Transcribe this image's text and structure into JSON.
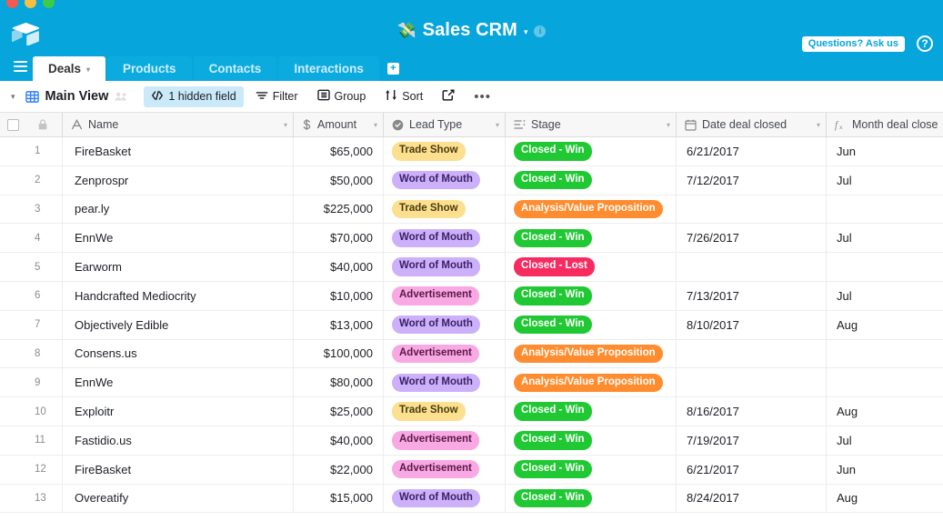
{
  "window": {
    "traffic_lights": [
      "close",
      "minimize",
      "zoom"
    ]
  },
  "header": {
    "logo_icon": "airtable-logo-icon",
    "base_icon": "money-icon",
    "base_title": "Sales CRM",
    "base_caret": "▾",
    "info_icon": "i",
    "ask_us_label": "Questions? Ask us",
    "help_label": "?"
  },
  "tabs": {
    "menu_icon": "hamburger-menu-icon",
    "items": [
      {
        "label": "Deals",
        "active": true,
        "caret": "▾"
      },
      {
        "label": "Products",
        "active": false
      },
      {
        "label": "Contacts",
        "active": false
      },
      {
        "label": "Interactions",
        "active": false
      }
    ],
    "add_label": "+"
  },
  "toolbar": {
    "view_caret": "▾",
    "view_icon": "grid-view-icon",
    "view_name": "Main View",
    "collaborators_icon": "collaborators-icon",
    "hidden_field_label": "1 hidden field",
    "hidden_field_icon": "hide-fields-icon",
    "filter_label": "Filter",
    "filter_icon": "filter-icon",
    "group_label": "Group",
    "group_icon": "group-icon",
    "sort_label": "Sort",
    "sort_icon": "sort-icon",
    "share_icon": "share-icon",
    "more_label": "•••"
  },
  "grid": {
    "select_all_icon": "checkbox-icon",
    "lock_icon": "lock-icon",
    "columns": [
      {
        "label": "Name",
        "icon": "text-field-icon",
        "caret": "▾"
      },
      {
        "label": "Amount",
        "icon": "currency-field-icon",
        "caret": "▾"
      },
      {
        "label": "Lead Type",
        "icon": "single-select-icon",
        "caret": "▾"
      },
      {
        "label": "Stage",
        "icon": "single-select-list-icon",
        "caret": "▾"
      },
      {
        "label": "Date deal closed",
        "icon": "date-field-icon",
        "caret": "▾"
      },
      {
        "label": "Month deal closed",
        "icon": "formula-field-icon",
        "caret": ""
      }
    ],
    "rows": [
      {
        "num": "1",
        "name": "FireBasket",
        "amount": "$65,000",
        "lead": "Trade Show",
        "lead_style": "trade",
        "stage": "Closed - Win",
        "stage_style": "win",
        "date": "6/21/2017",
        "month": "Jun"
      },
      {
        "num": "2",
        "name": "Zenprospr",
        "amount": "$50,000",
        "lead": "Word of Mouth",
        "lead_style": "wom",
        "stage": "Closed - Win",
        "stage_style": "win",
        "date": "7/12/2017",
        "month": "Jul"
      },
      {
        "num": "3",
        "name": "pear.ly",
        "amount": "$225,000",
        "lead": "Trade Show",
        "lead_style": "trade",
        "stage": "Analysis/Value Proposition",
        "stage_style": "anal",
        "date": "",
        "month": ""
      },
      {
        "num": "4",
        "name": "EnnWe",
        "amount": "$70,000",
        "lead": "Word of Mouth",
        "lead_style": "wom",
        "stage": "Closed - Win",
        "stage_style": "win",
        "date": "7/26/2017",
        "month": "Jul"
      },
      {
        "num": "5",
        "name": "Earworm",
        "amount": "$40,000",
        "lead": "Word of Mouth",
        "lead_style": "wom",
        "stage": "Closed - Lost",
        "stage_style": "lost",
        "date": "",
        "month": ""
      },
      {
        "num": "6",
        "name": "Handcrafted Mediocrity",
        "amount": "$10,000",
        "lead": "Advertisement",
        "lead_style": "ad",
        "stage": "Closed - Win",
        "stage_style": "win",
        "date": "7/13/2017",
        "month": "Jul"
      },
      {
        "num": "7",
        "name": "Objectively Edible",
        "amount": "$13,000",
        "lead": "Word of Mouth",
        "lead_style": "wom",
        "stage": "Closed - Win",
        "stage_style": "win",
        "date": "8/10/2017",
        "month": "Aug"
      },
      {
        "num": "8",
        "name": "Consens.us",
        "amount": "$100,000",
        "lead": "Advertisement",
        "lead_style": "ad",
        "stage": "Analysis/Value Proposition",
        "stage_style": "anal",
        "date": "",
        "month": ""
      },
      {
        "num": "9",
        "name": "EnnWe",
        "amount": "$80,000",
        "lead": "Word of Mouth",
        "lead_style": "wom",
        "stage": "Analysis/Value Proposition",
        "stage_style": "anal",
        "date": "",
        "month": ""
      },
      {
        "num": "10",
        "name": "Exploitr",
        "amount": "$25,000",
        "lead": "Trade Show",
        "lead_style": "trade",
        "stage": "Closed - Win",
        "stage_style": "win",
        "date": "8/16/2017",
        "month": "Aug"
      },
      {
        "num": "11",
        "name": "Fastidio.us",
        "amount": "$40,000",
        "lead": "Advertisement",
        "lead_style": "ad",
        "stage": "Closed - Win",
        "stage_style": "win",
        "date": "7/19/2017",
        "month": "Jul"
      },
      {
        "num": "12",
        "name": "FireBasket",
        "amount": "$22,000",
        "lead": "Advertisement",
        "lead_style": "ad",
        "stage": "Closed - Win",
        "stage_style": "win",
        "date": "6/21/2017",
        "month": "Jun"
      },
      {
        "num": "13",
        "name": "Overeatify",
        "amount": "$15,000",
        "lead": "Word of Mouth",
        "lead_style": "wom",
        "stage": "Closed - Win",
        "stage_style": "win",
        "date": "8/24/2017",
        "month": "Aug"
      }
    ]
  },
  "colors": {
    "brand_blue": "#06a5dc",
    "tab_blue": "#0cabdf",
    "highlight_blue": "#cae9f9",
    "green": "#20c933",
    "red": "#f82b60",
    "orange": "#ff8c2e",
    "yellow": "#fcdf8f",
    "purple": "#cdb0fa",
    "pink": "#f8a9e3"
  }
}
